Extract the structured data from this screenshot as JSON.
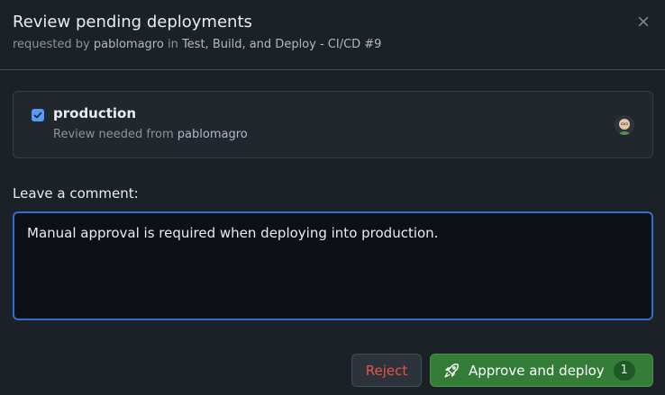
{
  "dialog": {
    "title": "Review pending deployments",
    "subtitle": {
      "prefix": "requested by ",
      "user": "pablomagro",
      "middle": " in ",
      "workflow": "Test, Build, and Deploy - CI/CD #9"
    },
    "close_icon": "close-icon"
  },
  "environment": {
    "checked": true,
    "name": "production",
    "review_prefix": "Review needed from ",
    "reviewer": "pablomagro",
    "avatar_icon": "avatar"
  },
  "comment": {
    "label": "Leave a comment:",
    "value": "Manual approval is required when deploying into production."
  },
  "actions": {
    "reject_label": "Reject",
    "approve_label": "Approve and deploy",
    "approve_count": "1",
    "approve_icon": "rocket-icon"
  },
  "colors": {
    "background": "#1c2128",
    "accent_blue": "#539bf5",
    "danger": "#e5534b",
    "success": "#347d39"
  }
}
